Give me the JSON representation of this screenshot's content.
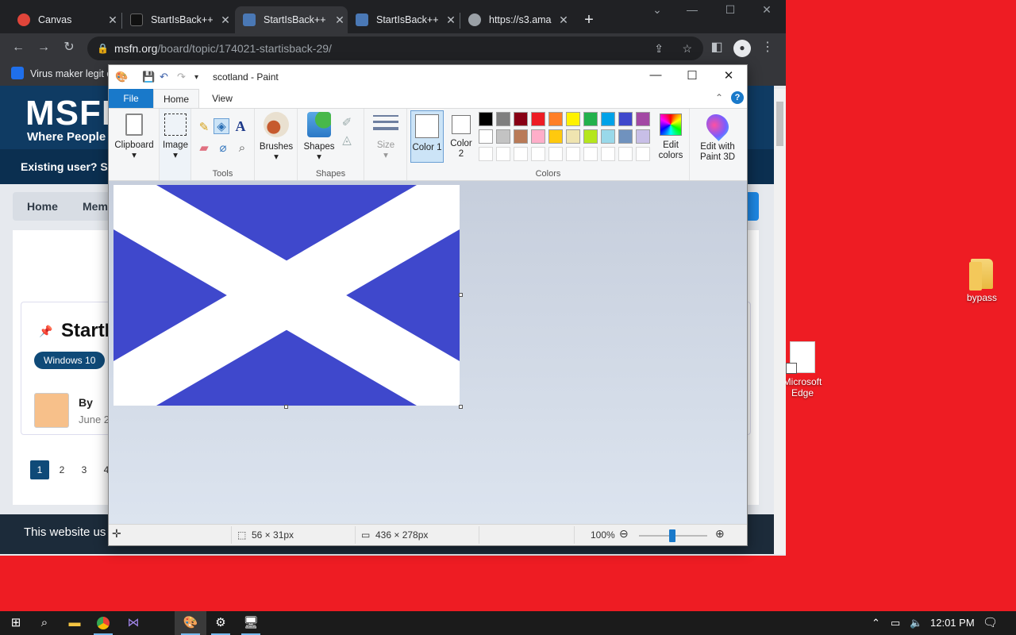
{
  "browser": {
    "tabs": [
      {
        "label": "Canvas",
        "favicon": "canvas-icon"
      },
      {
        "label": "StartIsBack++",
        "favicon": "startisback-icon"
      },
      {
        "label": "StartIsBack++",
        "favicon": "msfn-icon"
      },
      {
        "label": "StartIsBack++",
        "favicon": "msfn-icon"
      },
      {
        "label": "https://s3.ama",
        "favicon": "globe-icon"
      }
    ],
    "new_tab": "+",
    "url_domain": "msfn.org",
    "url_path": "/board/topic/174021-startisback-29/",
    "bookmark": "Virus maker legit c"
  },
  "webpage": {
    "logo": "MSFN",
    "tagline": "Where People",
    "user_bar": "Existing user? Sign",
    "crumbs": [
      "Home",
      "Mem"
    ],
    "topic_title": "StartI",
    "tag": "Windows 10",
    "by": "By",
    "date": "June 2",
    "pages": [
      "1",
      "2",
      "3",
      "4"
    ],
    "cookie": "This website us"
  },
  "paint": {
    "title": "scotland - Paint",
    "tabs": {
      "file": "File",
      "home": "Home",
      "view": "View"
    },
    "clipboard": "Clipboard",
    "image": "Image",
    "tools_label": "Tools",
    "brushes": "Brushes",
    "shapes": "Shapes",
    "shapes_label": "Shapes",
    "size": "Size",
    "color1": "Color 1",
    "color2": "Color 2",
    "edit_colors": "Edit colors",
    "colors_label": "Colors",
    "paint3d": "Edit with Paint 3D",
    "palette_row1": [
      "#000000",
      "#7f7f7f",
      "#880015",
      "#ed1c24",
      "#ff7f27",
      "#fff200",
      "#22b14c",
      "#00a2e8",
      "#3f48cc",
      "#a349a4"
    ],
    "palette_row2": [
      "#ffffff",
      "#c3c3c3",
      "#b97a57",
      "#ffaec9",
      "#ffc90e",
      "#efe4b0",
      "#b5e61d",
      "#99d9ea",
      "#7092be",
      "#c8bfe7"
    ],
    "status": {
      "selection": "56 × 31px",
      "size": "436 × 278px",
      "zoom": "100%"
    },
    "flag_blue": "#3f48cc"
  },
  "desktop": {
    "icons": [
      {
        "label": "bypass"
      },
      {
        "label": "Microsoft Edge"
      }
    ]
  },
  "taskbar": {
    "time": "12:01 PM"
  }
}
